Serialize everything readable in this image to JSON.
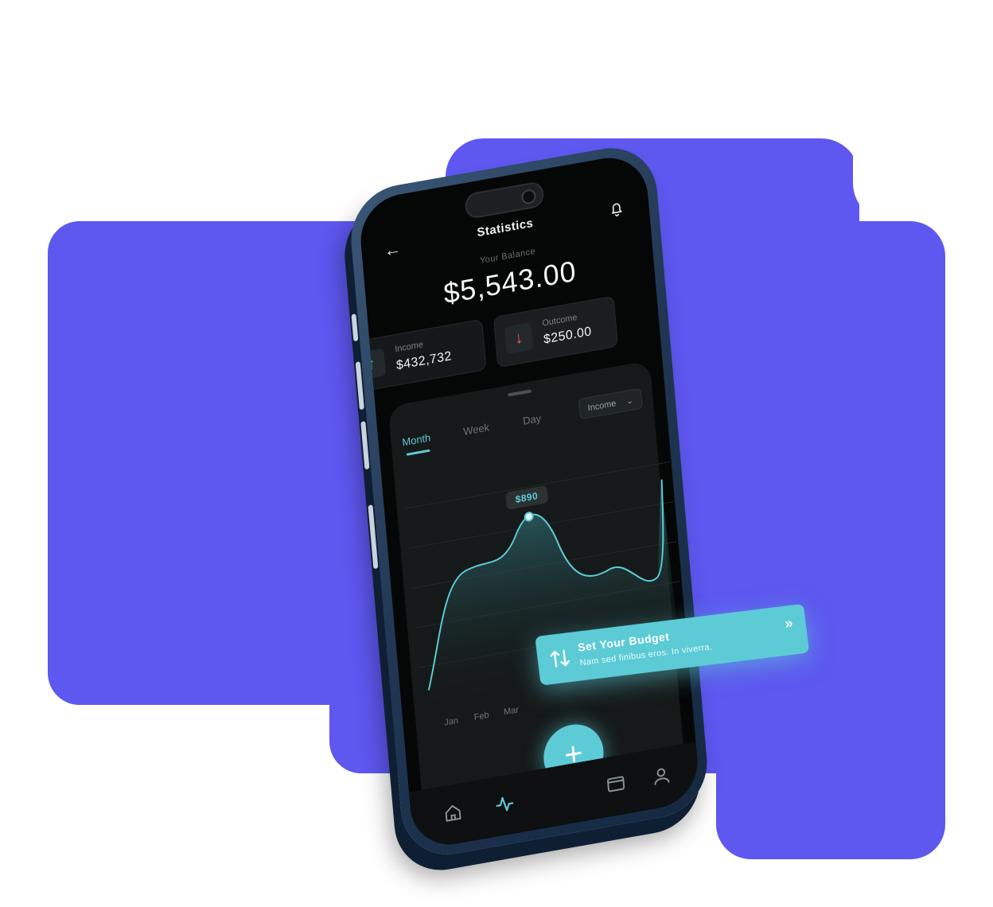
{
  "colors": {
    "background_blob": "#5E57F0",
    "accent": "#5ccbd6",
    "income_arrow": "#3ddc84",
    "outcome_arrow": "#ff5a4f"
  },
  "header": {
    "title": "Statistics",
    "back_icon": "arrow-left-icon",
    "notification_icon": "bell-icon"
  },
  "balance": {
    "label": "Your Balance",
    "value": "$5,543.00"
  },
  "income": {
    "label": "Income",
    "value": "$432,732",
    "icon": "arrow-up-icon"
  },
  "outcome": {
    "label": "Outcome",
    "value": "$250.00",
    "icon": "arrow-down-icon"
  },
  "chart_panel": {
    "tabs": [
      {
        "label": "Month",
        "active": true
      },
      {
        "label": "Week",
        "active": false
      },
      {
        "label": "Day",
        "active": false
      }
    ],
    "filter": {
      "selected": "Income"
    },
    "tooltip": "$890",
    "months": [
      "Jan",
      "Feb",
      "Mar"
    ]
  },
  "chart_data": {
    "type": "area",
    "title": "",
    "xlabel": "",
    "ylabel": "",
    "categories": [
      "Jan",
      "Feb",
      "Mar"
    ],
    "highlight_value": 890,
    "grid": true
  },
  "budget_card": {
    "title": "Set Your Budget",
    "subtitle": "Nam sed finibus eros. In viverra.",
    "icon": "swap-vertical-icon",
    "action_icon": "chevron-double-right-icon"
  },
  "navbar": {
    "items": [
      "home-icon",
      "activity-icon",
      "add-icon",
      "wallet-icon",
      "user-icon"
    ],
    "active": "activity-icon",
    "fab_label": "+"
  }
}
